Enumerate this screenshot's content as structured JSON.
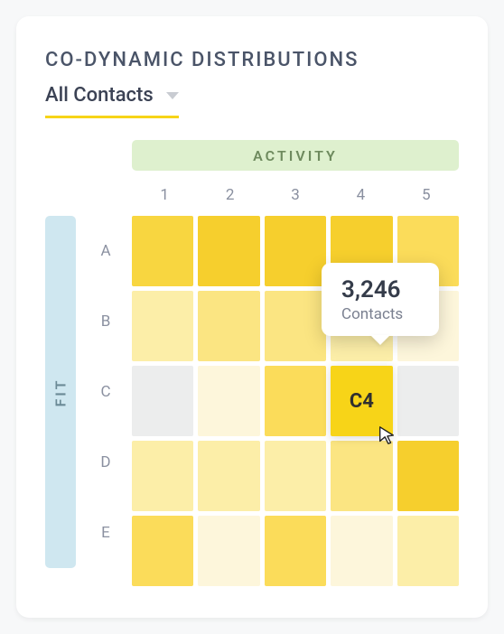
{
  "title": "CO-DYNAMIC DISTRIBUTIONS",
  "filter": {
    "label": "All Contacts"
  },
  "axes": {
    "x_label": "ACTIVITY",
    "y_label": "FIT"
  },
  "col_headers": [
    "1",
    "2",
    "3",
    "4",
    "5"
  ],
  "row_headers": [
    "A",
    "B",
    "C",
    "D",
    "E"
  ],
  "highlight": {
    "label": "C4"
  },
  "tooltip": {
    "value": "3,246",
    "label": "Contacts"
  },
  "chart_data": {
    "type": "heatmap",
    "title": "CO-DYNAMIC DISTRIBUTIONS",
    "xlabel": "ACTIVITY",
    "ylabel": "FIT",
    "x_categories": [
      "1",
      "2",
      "3",
      "4",
      "5"
    ],
    "y_categories": [
      "A",
      "B",
      "C",
      "D",
      "E"
    ],
    "color_scale_note": "relative intensity 0-10, darker yellow = higher; only labeled value is C4 = 3246 Contacts",
    "cells": [
      {
        "row": "A",
        "col": "1",
        "intensity": 6
      },
      {
        "row": "A",
        "col": "2",
        "intensity": 7
      },
      {
        "row": "A",
        "col": "3",
        "intensity": 7
      },
      {
        "row": "A",
        "col": "4",
        "intensity": 7
      },
      {
        "row": "A",
        "col": "5",
        "intensity": 5
      },
      {
        "row": "B",
        "col": "1",
        "intensity": 3
      },
      {
        "row": "B",
        "col": "2",
        "intensity": 4
      },
      {
        "row": "B",
        "col": "3",
        "intensity": 4
      },
      {
        "row": "B",
        "col": "4",
        "intensity": 3
      },
      {
        "row": "B",
        "col": "5",
        "intensity": 2
      },
      {
        "row": "C",
        "col": "1",
        "intensity": 0
      },
      {
        "row": "C",
        "col": "2",
        "intensity": 2
      },
      {
        "row": "C",
        "col": "3",
        "intensity": 5
      },
      {
        "row": "C",
        "col": "4",
        "intensity": 10,
        "value": 3246,
        "label": "C4"
      },
      {
        "row": "C",
        "col": "5",
        "intensity": 0
      },
      {
        "row": "D",
        "col": "1",
        "intensity": 3
      },
      {
        "row": "D",
        "col": "2",
        "intensity": 3
      },
      {
        "row": "D",
        "col": "3",
        "intensity": 3
      },
      {
        "row": "D",
        "col": "4",
        "intensity": 4
      },
      {
        "row": "D",
        "col": "5",
        "intensity": 7
      },
      {
        "row": "E",
        "col": "1",
        "intensity": 5
      },
      {
        "row": "E",
        "col": "2",
        "intensity": 2
      },
      {
        "row": "E",
        "col": "3",
        "intensity": 5
      },
      {
        "row": "E",
        "col": "4",
        "intensity": 2
      },
      {
        "row": "E",
        "col": "5",
        "intensity": 3
      }
    ],
    "palette": {
      "0": "#eceded",
      "2": "#fdf6db",
      "3": "#fceea8",
      "4": "#fbe582",
      "5": "#fbdc5a",
      "6": "#f8d640",
      "7": "#f6cf2d",
      "10": "#f7d418"
    }
  }
}
